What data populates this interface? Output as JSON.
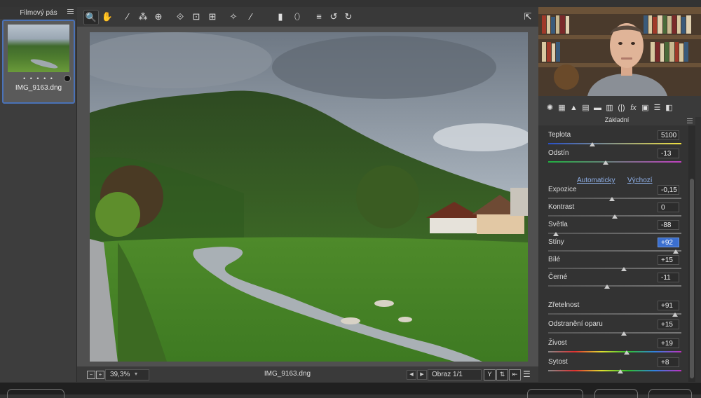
{
  "filmstrip": {
    "title": "Filmový pás",
    "thumbnail": {
      "rating_dots": "• • • • •",
      "filename": "IMG_9163.dng"
    }
  },
  "toolbar": {
    "tools": [
      "zoom-icon",
      "hand-icon",
      "white-balance-icon",
      "color-sampler-icon",
      "targeted-adjustment-icon",
      "crop-icon",
      "spot-removal-icon",
      "transform-icon",
      "red-eye-icon",
      "adjustment-brush-icon",
      "graduated-filter-icon",
      "radial-filter-icon",
      "preferences-icon",
      "rotate-left-icon",
      "rotate-right-icon"
    ],
    "glyphs": [
      "🔍",
      "✋",
      "⁄",
      "⁂",
      "⊕",
      "⟐",
      "⊡",
      "⊞",
      "✧",
      "⁄",
      "▮",
      "⬯",
      "≡",
      "↺",
      "↻"
    ],
    "fullscreen_glyph": "⇱"
  },
  "status_bar": {
    "zoom": "39,3%",
    "filename": "IMG_9163.dng",
    "image_count": "Obraz 1/1",
    "zoom_out": "−",
    "zoom_in": "+"
  },
  "panel": {
    "section_title": "Základní",
    "auto_label": "Automaticky",
    "default_label": "Výchozí",
    "sliders": [
      {
        "label": "Teplota",
        "value": "5100",
        "pos": 0.33,
        "track": "temp"
      },
      {
        "label": "Odstín",
        "value": "-13",
        "pos": 0.43,
        "track": "tint"
      },
      {
        "label": "Expozice",
        "value": "-0,15",
        "pos": 0.48,
        "track": "gray"
      },
      {
        "label": "Kontrast",
        "value": "0",
        "pos": 0.5,
        "track": "gray"
      },
      {
        "label": "Světla",
        "value": "-88",
        "pos": 0.06,
        "track": "gray"
      },
      {
        "label": "Stíny",
        "value": "+92",
        "pos": 0.96,
        "track": "gray",
        "active": true
      },
      {
        "label": "Bílé",
        "value": "+15",
        "pos": 0.57,
        "track": "gray"
      },
      {
        "label": "Černé",
        "value": "-11",
        "pos": 0.44,
        "track": "gray"
      },
      {
        "label": "Zřetelnost",
        "value": "+91",
        "pos": 0.95,
        "track": "gray"
      },
      {
        "label": "Odstranění oparu",
        "value": "+15",
        "pos": 0.57,
        "track": "gray"
      },
      {
        "label": "Živost",
        "value": "+19",
        "pos": 0.59,
        "track": "sat"
      },
      {
        "label": "Sytost",
        "value": "+8",
        "pos": 0.54,
        "track": "sat"
      }
    ]
  },
  "colors": {
    "accent": "#3b6fcf",
    "panel_bg": "#333333",
    "link": "#8fb0e8"
  }
}
